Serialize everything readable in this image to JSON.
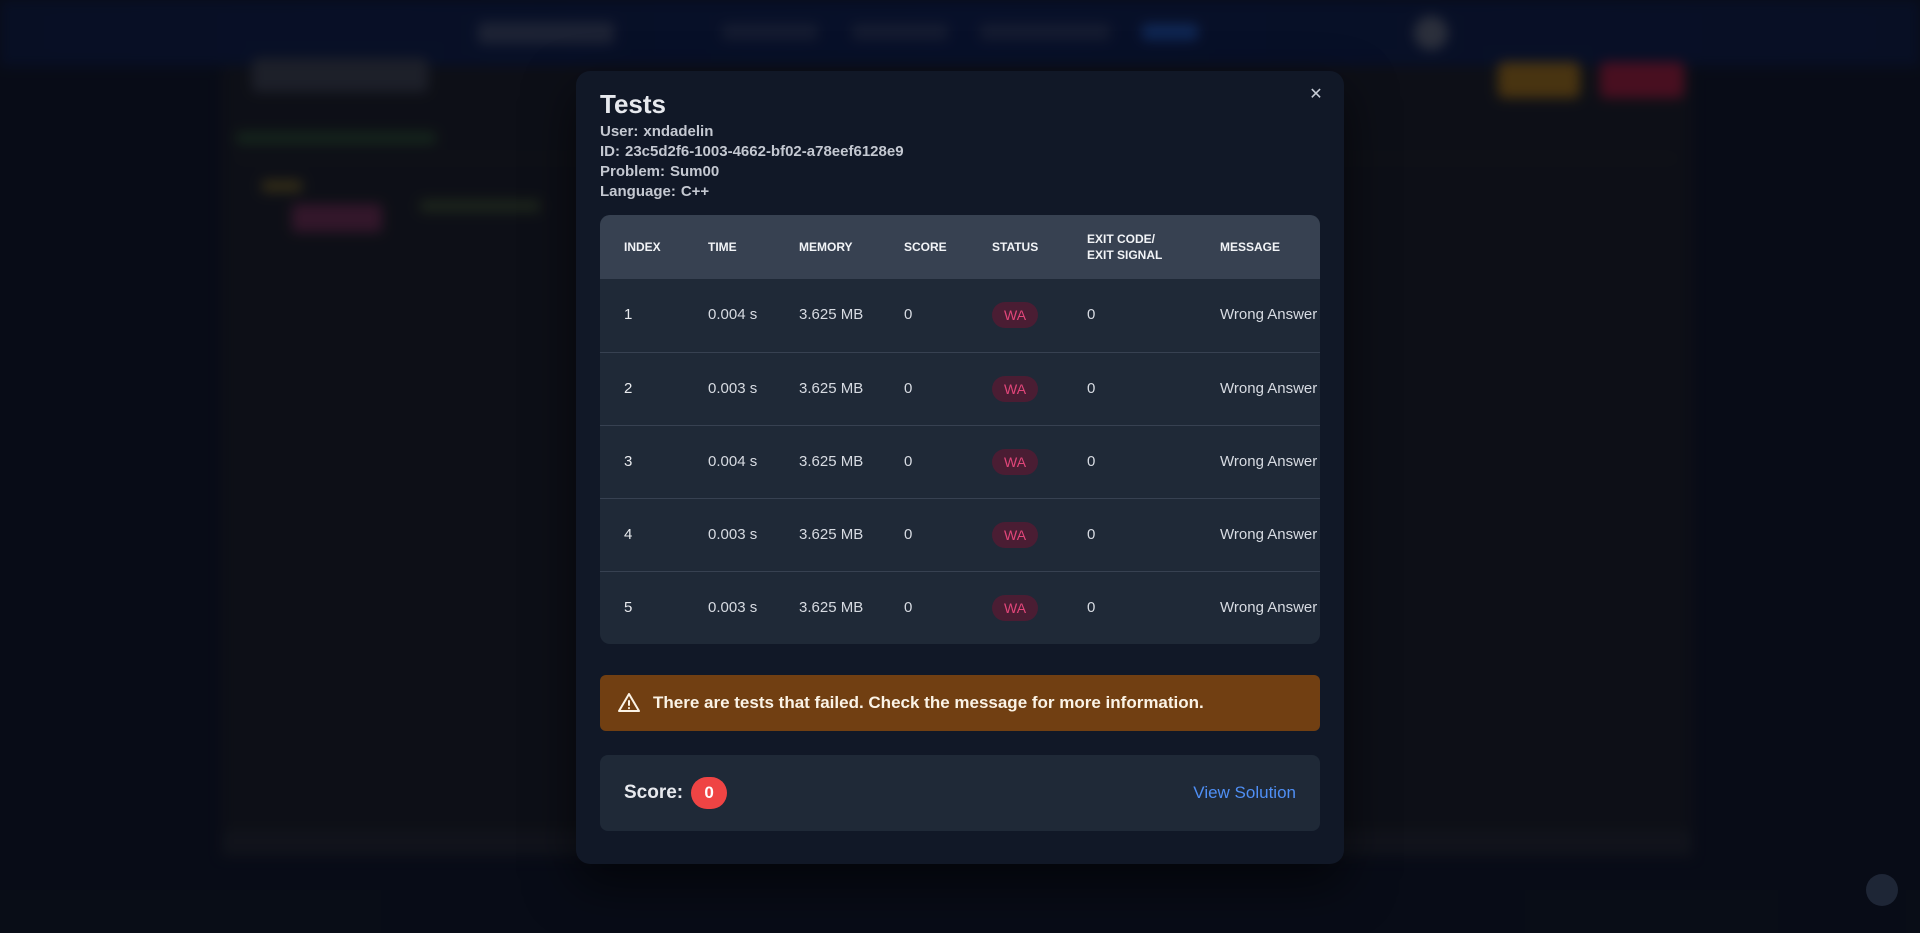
{
  "modal": {
    "title": "Tests",
    "close_icon": "close-icon",
    "meta": [
      {
        "key": "user",
        "label": "User:",
        "value": "xndadelin"
      },
      {
        "key": "id",
        "label": "ID:",
        "value": "23c5d2f6-1003-4662-bf02-a78eef6128e9"
      },
      {
        "key": "problem",
        "label": "Problem:",
        "value": "Sum00"
      },
      {
        "key": "language",
        "label": "Language:",
        "value": "C++"
      }
    ]
  },
  "table": {
    "headers": [
      "Index",
      "Time",
      "Memory",
      "Score",
      "Status",
      "Exit code/\nexit signal",
      "Message"
    ],
    "rows": [
      {
        "index": "1",
        "time": "0.004 s",
        "memory": "3.625 MB",
        "score": "0",
        "status": "WA",
        "exit": "0",
        "message": "Wrong Answer"
      },
      {
        "index": "2",
        "time": "0.003 s",
        "memory": "3.625 MB",
        "score": "0",
        "status": "WA",
        "exit": "0",
        "message": "Wrong Answer"
      },
      {
        "index": "3",
        "time": "0.004 s",
        "memory": "3.625 MB",
        "score": "0",
        "status": "WA",
        "exit": "0",
        "message": "Wrong Answer"
      },
      {
        "index": "4",
        "time": "0.003 s",
        "memory": "3.625 MB",
        "score": "0",
        "status": "WA",
        "exit": "0",
        "message": "Wrong Answer"
      },
      {
        "index": "5",
        "time": "0.003 s",
        "memory": "3.625 MB",
        "score": "0",
        "status": "WA",
        "exit": "0",
        "message": "Wrong Answer"
      }
    ]
  },
  "alert": {
    "icon": "warning-triangle-icon",
    "text": "There are tests that failed. Check the message for more information.",
    "color": "#713f12"
  },
  "score": {
    "label": "Score:",
    "value": "0",
    "badge_color": "#ef4444",
    "view_solution_label": "View Solution"
  },
  "colors": {
    "modal_bg": "#111827",
    "table_bg": "#1f2937",
    "header_bg": "#374151",
    "wa_badge_text": "#e2467a",
    "link": "#4f8ff5"
  }
}
